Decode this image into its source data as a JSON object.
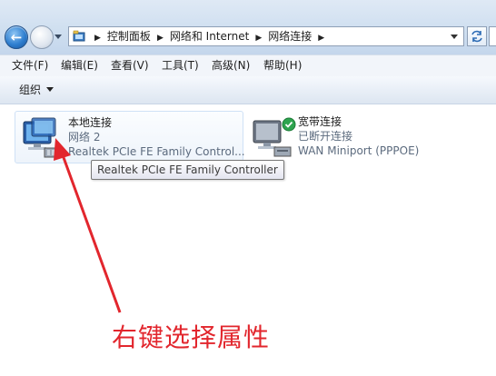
{
  "address_bar": {
    "breadcrumbs": [
      "控制面板",
      "网络和 Internet",
      "网络连接"
    ],
    "nav_icon": "back-arrow-icon",
    "refresh_icon": "refresh-icon"
  },
  "menu": {
    "items": [
      "文件(F)",
      "编辑(E)",
      "查看(V)",
      "工具(T)",
      "高级(N)",
      "帮助(H)"
    ]
  },
  "command_bar": {
    "organize_label": "组织"
  },
  "connections": [
    {
      "name": "本地连接",
      "status": "网络  2",
      "device": "Realtek PCIe FE Family Control...",
      "icon": "network-adapter-icon",
      "selected": true
    },
    {
      "name": "宽带连接",
      "status": "已断开连接",
      "device": "WAN Miniport (PPPOE)",
      "icon": "broadband-connection-icon",
      "selected": false
    }
  ],
  "tooltip": {
    "text": "Realtek PCIe FE Family Controller"
  },
  "annotation": {
    "text": "右键选择属性",
    "color": "#e2262d"
  },
  "colors": {
    "address_bar_bg": "#cfdff0",
    "selection_border": "#cfe1f6",
    "secondary_text": "#5c6b7e",
    "status_ok": "#2ea44f"
  }
}
